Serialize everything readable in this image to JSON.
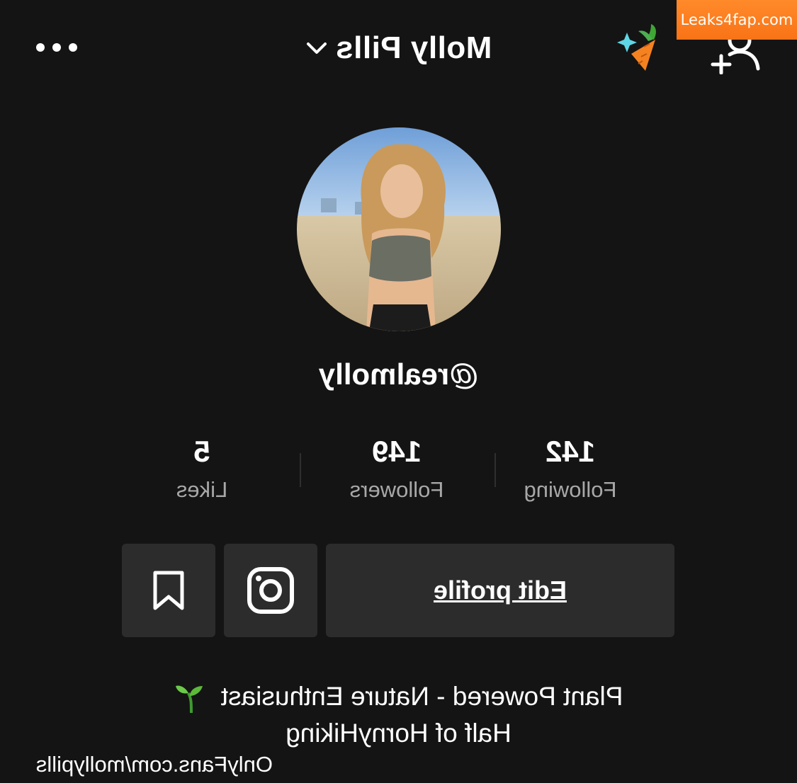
{
  "header": {
    "title": "Molly Pills",
    "more_icon": "more-dots-icon",
    "add_friend_icon": "add-friend-icon",
    "badge_emoji": "carrot-sparkle-emoji"
  },
  "profile": {
    "username": "@realmolly",
    "stats": [
      {
        "value": "142",
        "label": "Following"
      },
      {
        "value": "149",
        "label": "Followers"
      },
      {
        "value": "5",
        "label": "Likes"
      }
    ],
    "edit_label": "Edit profile",
    "bio_line_1": "Plant Powered - Nature Enthusiast",
    "bio_line_2": "Half of HornyHiking",
    "link": "OnlyFans.com/mollypills"
  },
  "watermark": "Leaks4fap.com",
  "colors": {
    "background": "#141414",
    "button": "#2c2c2c",
    "secondary_text": "#a8a8a8",
    "watermark": "#f97316"
  }
}
